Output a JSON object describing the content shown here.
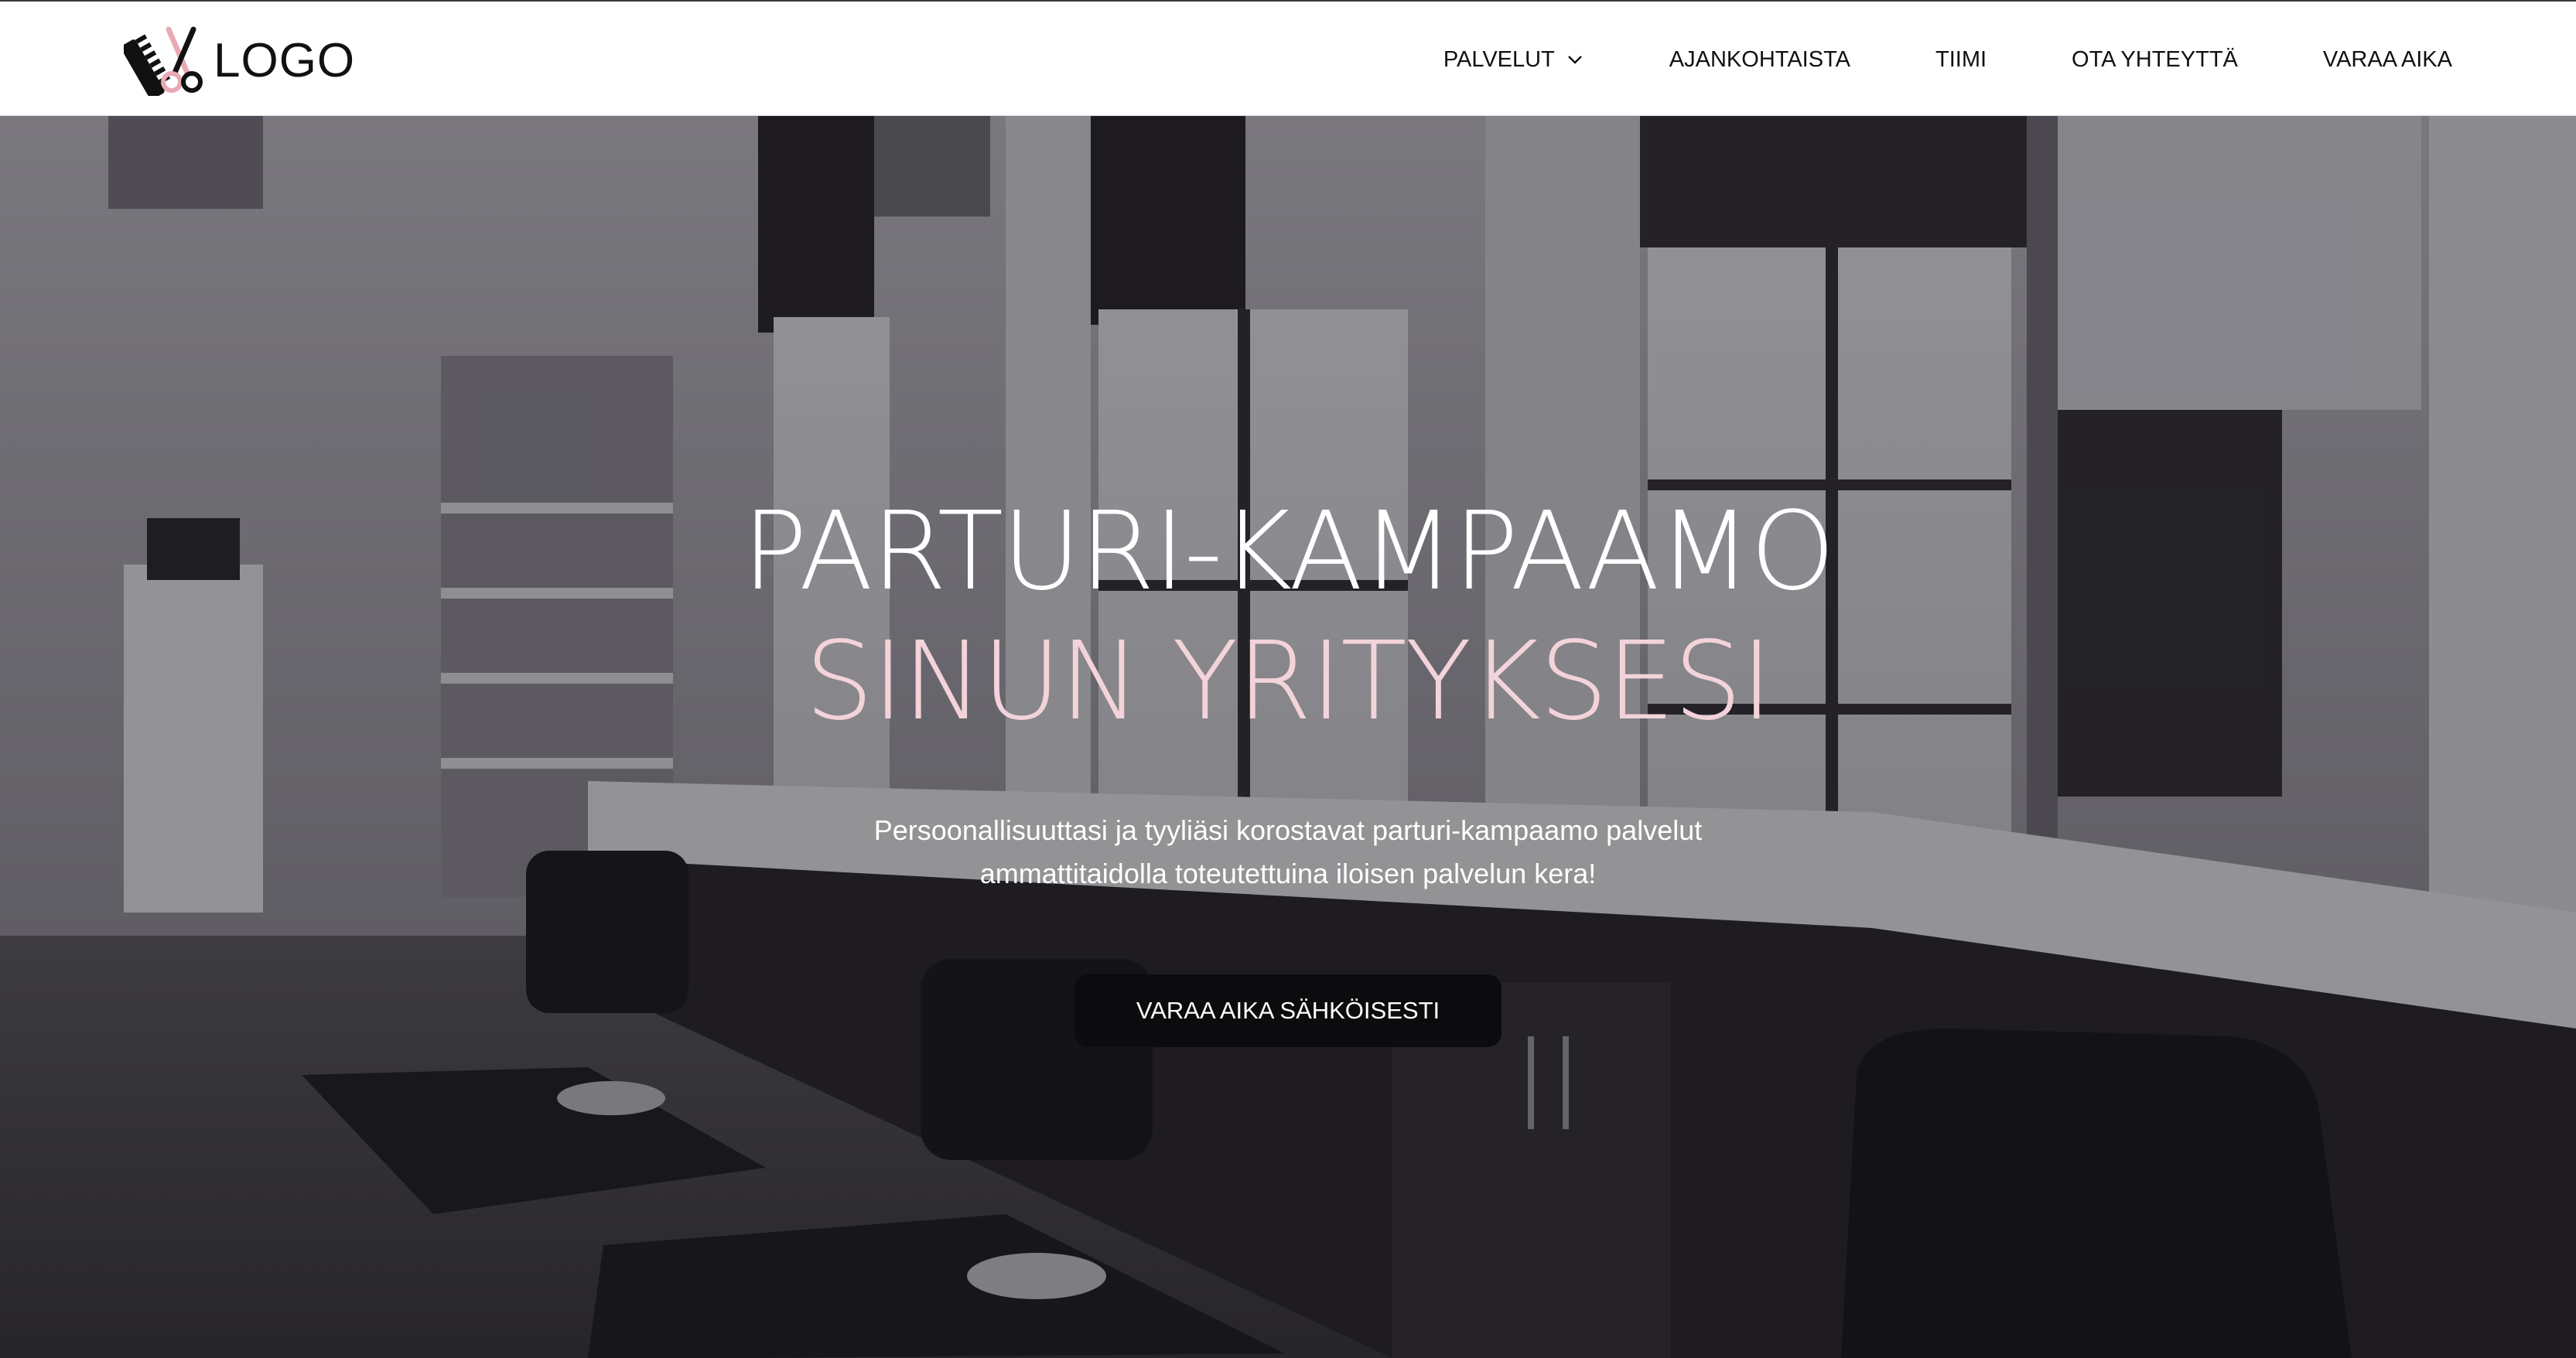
{
  "header": {
    "logo_text": "LOGO",
    "nav": [
      {
        "label": "PALVELUT",
        "has_dropdown": true
      },
      {
        "label": "AJANKOHTAISTA"
      },
      {
        "label": "TIIMI"
      },
      {
        "label": "OTA YHTEYTTÄ"
      },
      {
        "label": "VARAA AIKA"
      }
    ]
  },
  "hero": {
    "title_line1": "PARTURI-KAMPAAMO",
    "title_line2": "SINUN YRITYKSESI",
    "lead": "Persoonallisuuttasi ja tyyliäsi korostavat parturi-kampaamo palvelut ammattitaidolla toteutettuina iloisen palvelun kera!",
    "cta_label": "VARAA AIKA SÄHKÖISESTI"
  },
  "colors": {
    "accent_pink": "#f3d3da",
    "logo_pink": "#e8a9b5",
    "cta_background": "#0c0b0d",
    "text_dark": "#111111"
  },
  "icons": {
    "logo": "comb-and-scissors-icon",
    "dropdown": "chevron-down-icon"
  }
}
